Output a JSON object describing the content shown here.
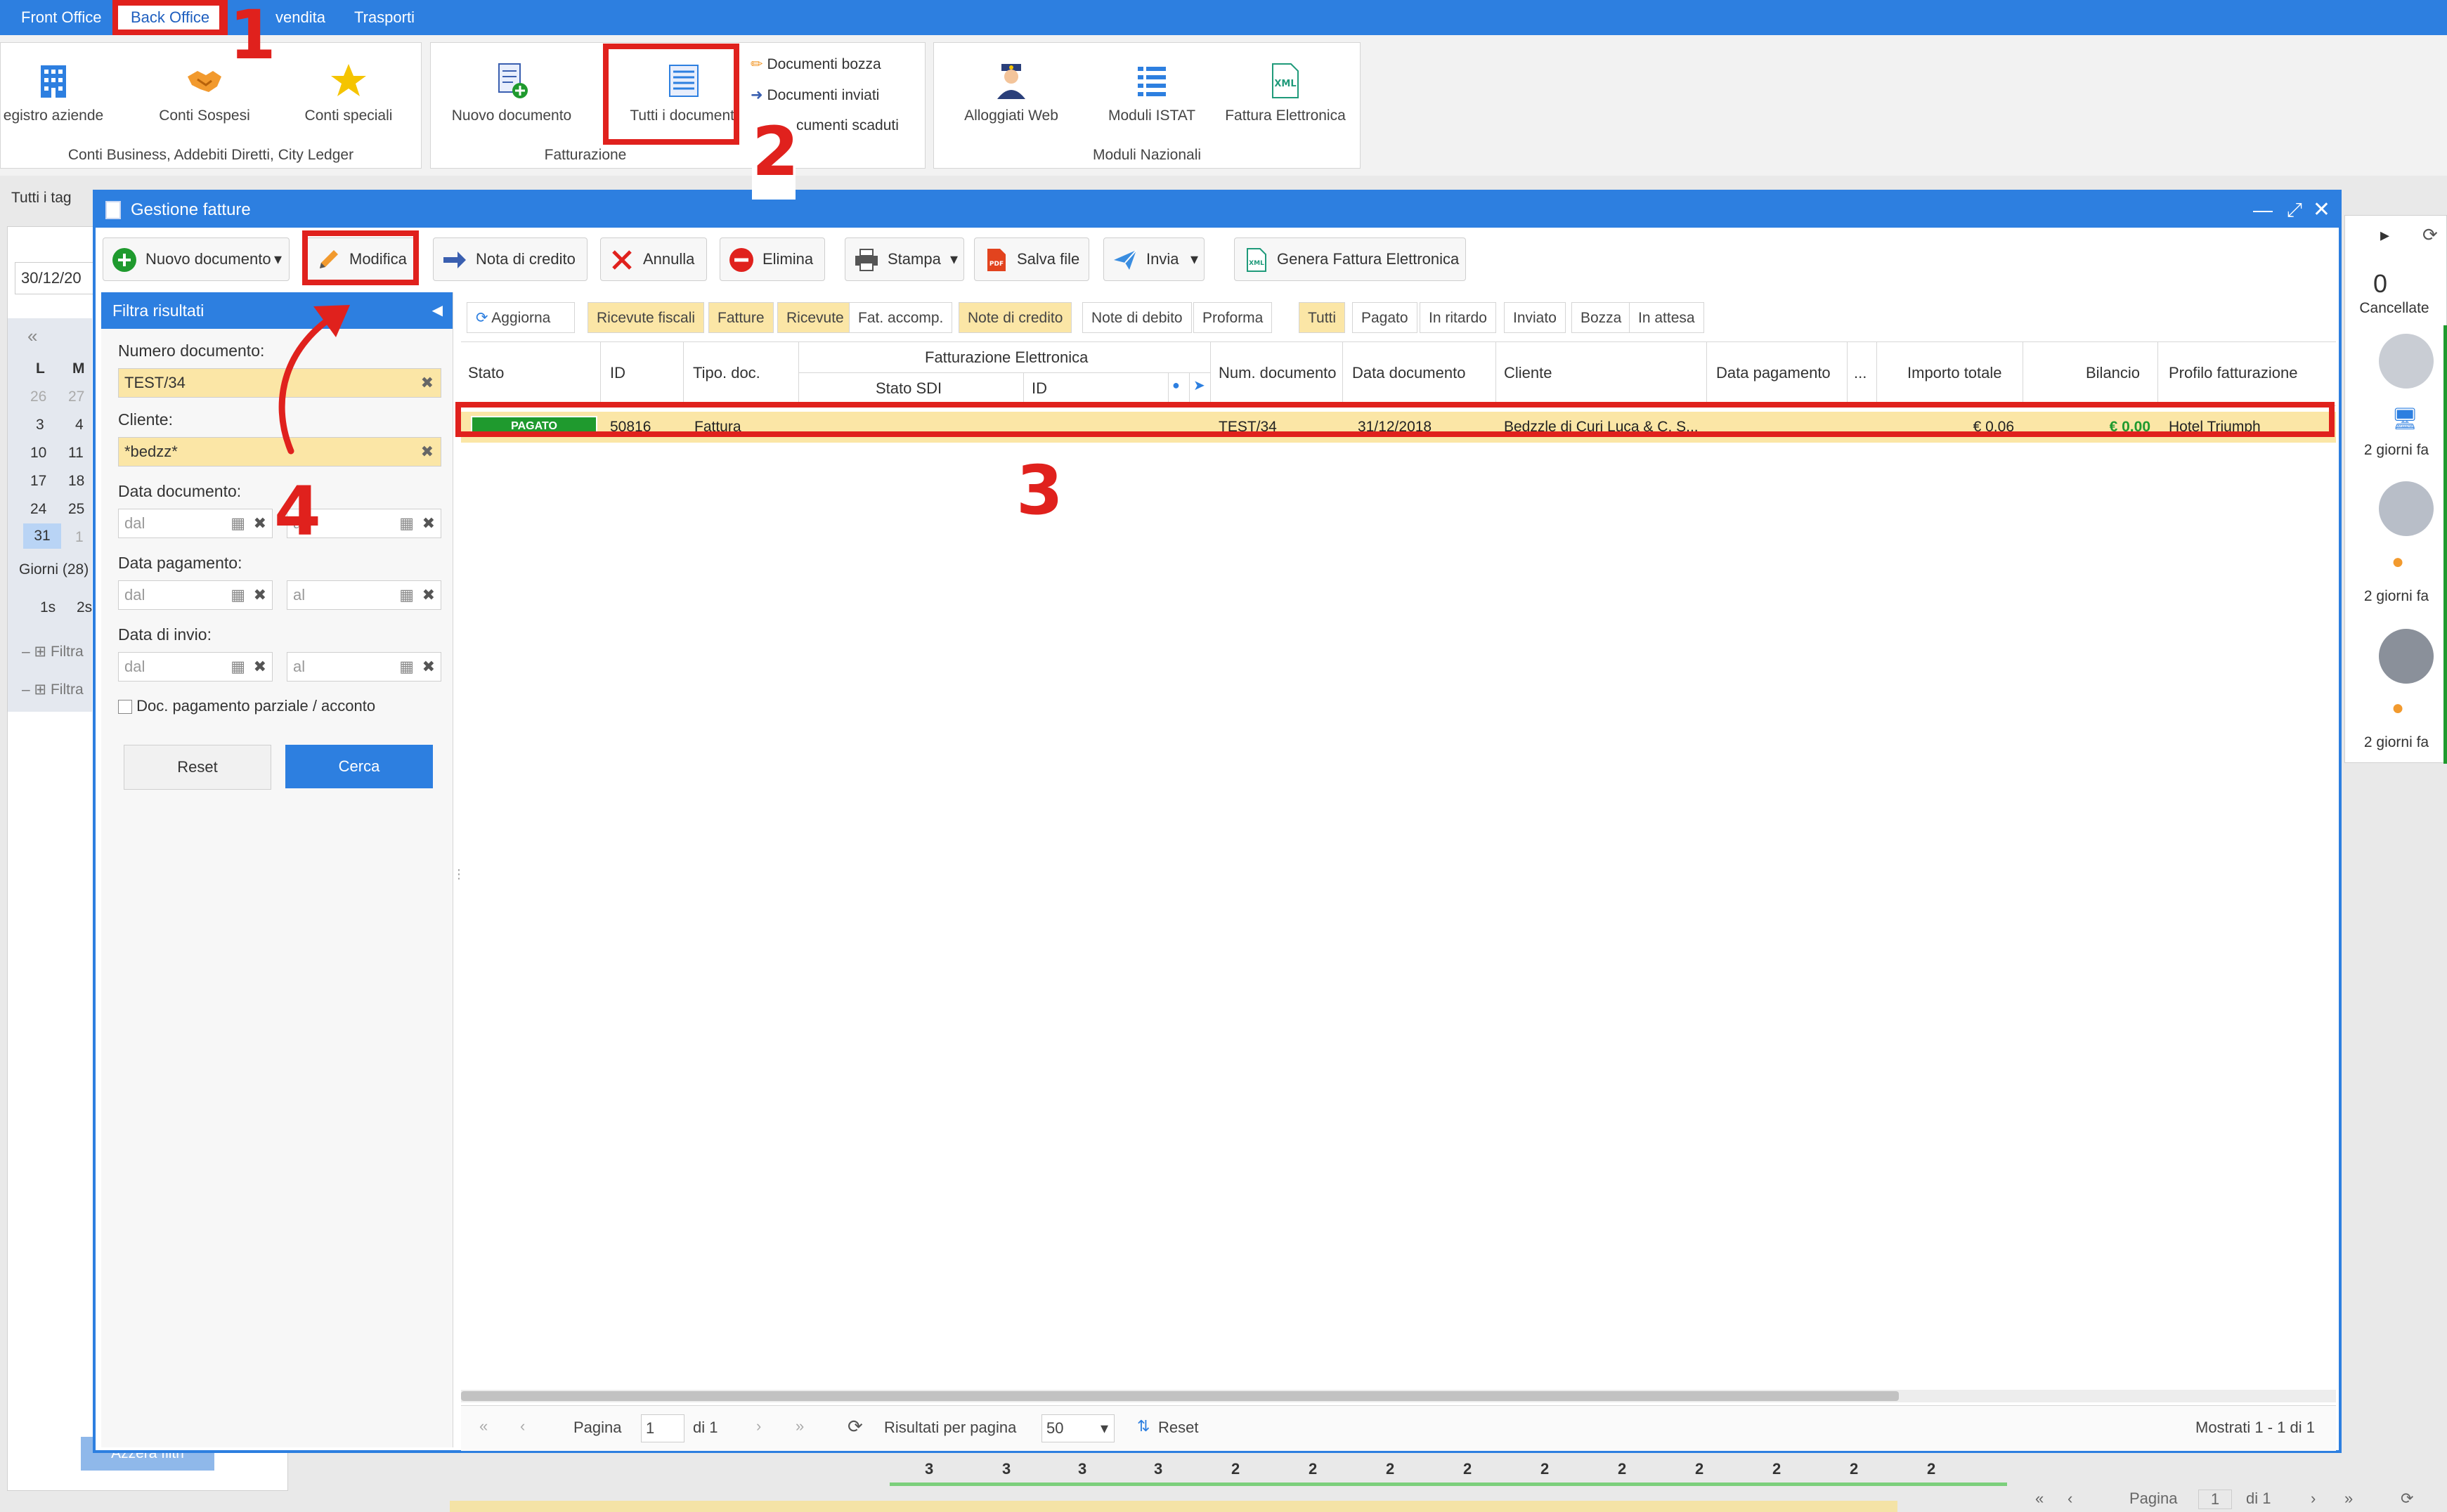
{
  "top_tabs": [
    {
      "label": "Front Office"
    },
    {
      "label": "Back Office"
    },
    {
      "label": "vendita"
    },
    {
      "label": "Trasporti"
    }
  ],
  "ribbon": {
    "group1": {
      "title": "Conti Business, Addebiti Diretti, City Ledger",
      "buttons": [
        "egistro aziende",
        "Conti Sospesi",
        "Conti speciali"
      ]
    },
    "group2": {
      "title": "Fatturazione",
      "buttons": [
        "Nuovo documento",
        "Tutti i documenti"
      ],
      "small_items": [
        "Documenti bozza",
        "Documenti inviati",
        "cumenti scaduti"
      ]
    },
    "group3": {
      "title": "Moduli Nazionali",
      "buttons": [
        "Alloggiati Web",
        "Moduli ISTAT",
        "Fattura Elettronica"
      ]
    }
  },
  "annotations": [
    "1",
    "2",
    "3",
    "4"
  ],
  "background": {
    "tag_label": "Tutti i tag",
    "date_value": "30/12/20",
    "calendar_days": [
      "L",
      "M"
    ],
    "calendar_rows": [
      [
        "26",
        "27"
      ],
      [
        "3",
        "4"
      ],
      [
        "10",
        "11"
      ],
      [
        "17",
        "18"
      ],
      [
        "24",
        "25"
      ],
      [
        "31",
        "1"
      ]
    ],
    "days_count": "Giorni (28)",
    "range_btns": [
      "1s",
      "2s"
    ],
    "filter_rows": [
      "Filtra",
      "Filtra"
    ],
    "reset_filters": "Azzera filtri",
    "right_count": "0",
    "right_label": "Cancellate",
    "right_ago": [
      "2 giorni fa",
      "2 giorni fa",
      "2 giorni fa"
    ],
    "bottom_numbers": [
      "3",
      "3",
      "3",
      "3",
      "2",
      "2",
      "2",
      "2",
      "2",
      "2",
      "2",
      "2",
      "2",
      "2"
    ],
    "bottom_pager": {
      "label": "Pagina",
      "value": "1",
      "of": "di 1"
    }
  },
  "dialog": {
    "title": "Gestione fatture",
    "toolbar": {
      "new_doc": "Nuovo documento",
      "edit": "Modifica",
      "credit_note": "Nota di credito",
      "cancel": "Annulla",
      "delete": "Elimina",
      "print": "Stampa",
      "save_file": "Salva file",
      "send": "Invia",
      "gen_einvoice": "Genera Fattura Elettronica"
    },
    "filter": {
      "header": "Filtra risultati",
      "doc_number_label": "Numero documento:",
      "doc_number_value": "TEST/34",
      "client_label": "Cliente:",
      "client_value": "*bedzz*",
      "doc_date_label": "Data documento:",
      "pay_date_label": "Data pagamento:",
      "send_date_label": "Data di invio:",
      "from_placeholder": "dal",
      "to_placeholder": "al",
      "partial_label": "Doc. pagamento parziale / acconto",
      "reset": "Reset",
      "search": "Cerca"
    },
    "refresh": "Aggiorna",
    "type_chips": [
      "Ricevute fiscali",
      "Fatture",
      "Ricevute",
      "Fat. accomp.",
      "Note di credito",
      "Note di debito",
      "Proforma"
    ],
    "status_chips": [
      "Tutti",
      "Pagato",
      "In ritardo",
      "Inviato",
      "Bozza",
      "In attesa"
    ],
    "columns": {
      "stato": "Stato",
      "id": "ID",
      "tipo": "Tipo. doc.",
      "fe_group": "Fatturazione Elettronica",
      "stato_sdi": "Stato SDI",
      "fe_id": "ID",
      "num_doc": "Num. documento",
      "data_doc": "Data documento",
      "cliente": "Cliente",
      "data_pag": "Data pagamento",
      "more": "...",
      "importo": "Importo totale",
      "bilancio": "Bilancio",
      "profilo": "Profilo fatturazione"
    },
    "rows": [
      {
        "stato": "PAGATO",
        "id": "50816",
        "tipo": "Fattura",
        "num_doc": "TEST/34",
        "data_doc": "31/12/2018",
        "cliente": "Bedzzle di Curi Luca & C. S...",
        "importo": "€ 0.06",
        "bilancio": "€ 0.00",
        "profilo": "Hotel Triumph"
      }
    ],
    "pager": {
      "page_label": "Pagina",
      "page_value": "1",
      "of": "di 1",
      "per_page_label": "Risultati per pagina",
      "per_page_value": "50",
      "reset": "Reset",
      "shown": "Mostrati 1 - 1 di 1"
    }
  },
  "colors": {
    "accent": "#2d7fe0",
    "annotation": "#e0211d",
    "highlight": "#fbe6a6",
    "paid": "#1f9a2e"
  }
}
